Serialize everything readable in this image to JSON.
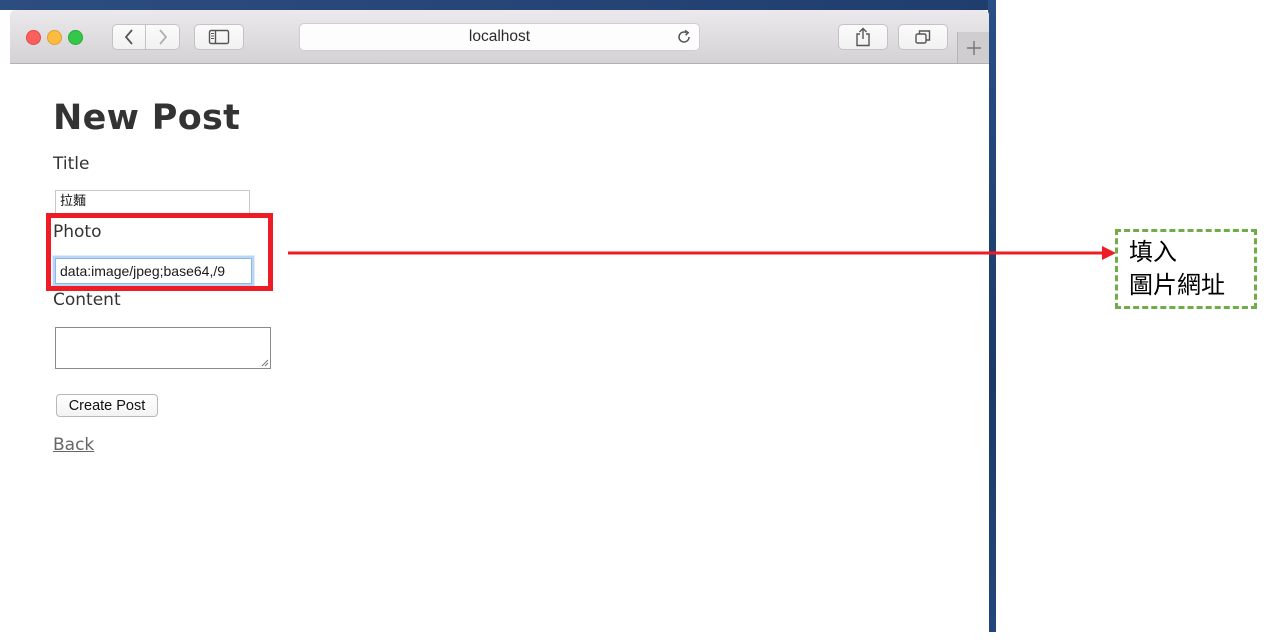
{
  "browser": {
    "address": "localhost"
  },
  "page": {
    "title": "New Post",
    "form": {
      "title_label": "Title",
      "title_value": "拉麵",
      "photo_label": "Photo",
      "photo_value": "data:image/jpeg;base64,/9",
      "content_label": "Content",
      "content_value": "",
      "submit_label": "Create Post"
    },
    "back_link": "Back"
  },
  "annotation": {
    "highlight_color": "#ee1c25",
    "callout_border_color": "#70ad47",
    "callout_lines": [
      "填入",
      "圖片網址"
    ]
  }
}
